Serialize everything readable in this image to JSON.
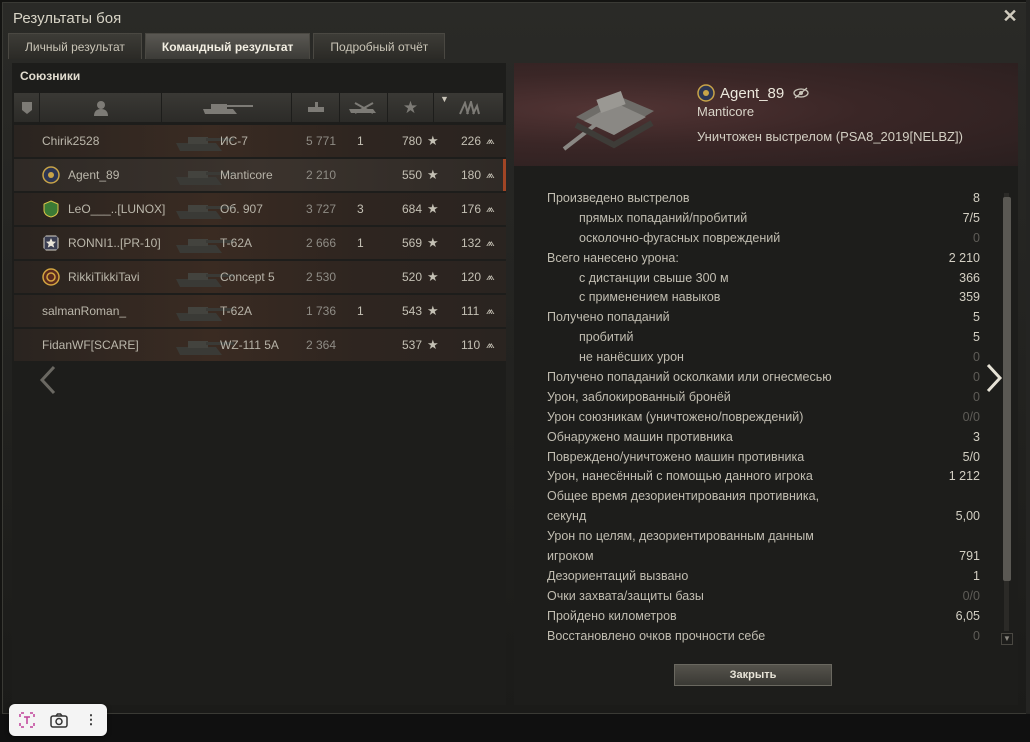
{
  "window": {
    "title": "Результаты боя"
  },
  "tabs": [
    {
      "label": "Личный результат"
    },
    {
      "label": "Командный результат"
    },
    {
      "label": "Подробный отчёт"
    }
  ],
  "allies": {
    "section_title": "Союзники",
    "column_icons": [
      "rank-icon",
      "player-icon",
      "tank-icon",
      "damage-icon",
      "frags-icon",
      "xp-star-icon",
      "sort-arrow-icon",
      "free-xp-icon"
    ],
    "rows": [
      {
        "name": "Chirik2528",
        "vehicle": "ИС-7",
        "damage": "5 771",
        "kills": "1",
        "xp": "780",
        "fxp": "226"
      },
      {
        "name": "Agent_89",
        "vehicle": "Manticore",
        "damage": "2 210",
        "kills": "",
        "xp": "550",
        "fxp": "180"
      },
      {
        "name": "LeO___..[LUNOX]",
        "vehicle": "Об. 907",
        "damage": "3 727",
        "kills": "3",
        "xp": "684",
        "fxp": "176"
      },
      {
        "name": "RONNI1..[PR-10]",
        "vehicle": "T-62A",
        "damage": "2 666",
        "kills": "1",
        "xp": "569",
        "fxp": "132"
      },
      {
        "name": "RikkiTikkiTavi",
        "vehicle": "Concept 5",
        "damage": "2 530",
        "kills": "",
        "xp": "520",
        "fxp": "120"
      },
      {
        "name": "salmanRoman_",
        "vehicle": "T-62A",
        "damage": "1 736",
        "kills": "1",
        "xp": "543",
        "fxp": "111"
      },
      {
        "name": "FidanWF[SCARE]",
        "vehicle": "WZ-111 5A",
        "damage": "2 364",
        "kills": "",
        "xp": "537",
        "fxp": "110"
      }
    ],
    "star": "★",
    "fxp_glyph": "⩕"
  },
  "detail": {
    "player": "Agent_89",
    "vehicle": "Manticore",
    "killed_by": "Уничтожен выстрелом (PSA8_2019[NELBZ])",
    "stats": [
      {
        "label": "Произведено выстрелов",
        "value": "8"
      },
      {
        "label": "прямых попаданий/пробитий",
        "value": "7/5",
        "sub": true
      },
      {
        "label": "осколочно-фугасных повреждений",
        "value": "0",
        "sub": true,
        "dim": true
      },
      {
        "label": "Всего нанесено урона:",
        "value": "2 210"
      },
      {
        "label": "с дистанции свыше 300 м",
        "value": "366",
        "sub": true
      },
      {
        "label": "с применением навыков",
        "value": "359",
        "sub": true
      },
      {
        "label": "Получено попаданий",
        "value": "5"
      },
      {
        "label": "пробитий",
        "value": "5",
        "sub": true
      },
      {
        "label": "не нанёсших урон",
        "value": "0",
        "sub": true,
        "dim": true
      },
      {
        "label": "Получено попаданий осколками или огнесмесью",
        "value": "0",
        "dim": true
      },
      {
        "label": "Урон, заблокированный бронёй",
        "value": "0",
        "dim": true
      },
      {
        "label": "Урон союзникам (уничтожено/повреждений)",
        "value": "0/0",
        "dim": true
      },
      {
        "label": "Обнаружено машин противника",
        "value": "3"
      },
      {
        "label": "Повреждено/уничтожено машин противника",
        "value": "5/0"
      },
      {
        "label": "Урон, нанесённый с помощью данного игрока",
        "value": "1 212"
      },
      {
        "label": "Общее время дезориентирования противника,",
        "value": ""
      },
      {
        "label": "секунд",
        "value": "5,00"
      },
      {
        "label": "Урон по целям, дезориентированным данным",
        "value": ""
      },
      {
        "label": "игроком",
        "value": "791"
      },
      {
        "label": "Дезориентаций вызвано",
        "value": "1"
      },
      {
        "label": "Очки захвата/защиты базы",
        "value": "0/0",
        "dim": true
      },
      {
        "label": "Пройдено километров",
        "value": "6,05"
      },
      {
        "label": "Восстановлено очков прочности себе",
        "value": "0",
        "dim": true
      }
    ],
    "close_label": "Закрыть"
  },
  "toolbar": {
    "icons": [
      "text-select-icon",
      "camera-icon",
      "more-icon"
    ],
    "more_glyph": "⋮"
  },
  "colors": {
    "accent": "#a04525",
    "panel": "#1d1d1b",
    "header_red": "#3a2626"
  }
}
